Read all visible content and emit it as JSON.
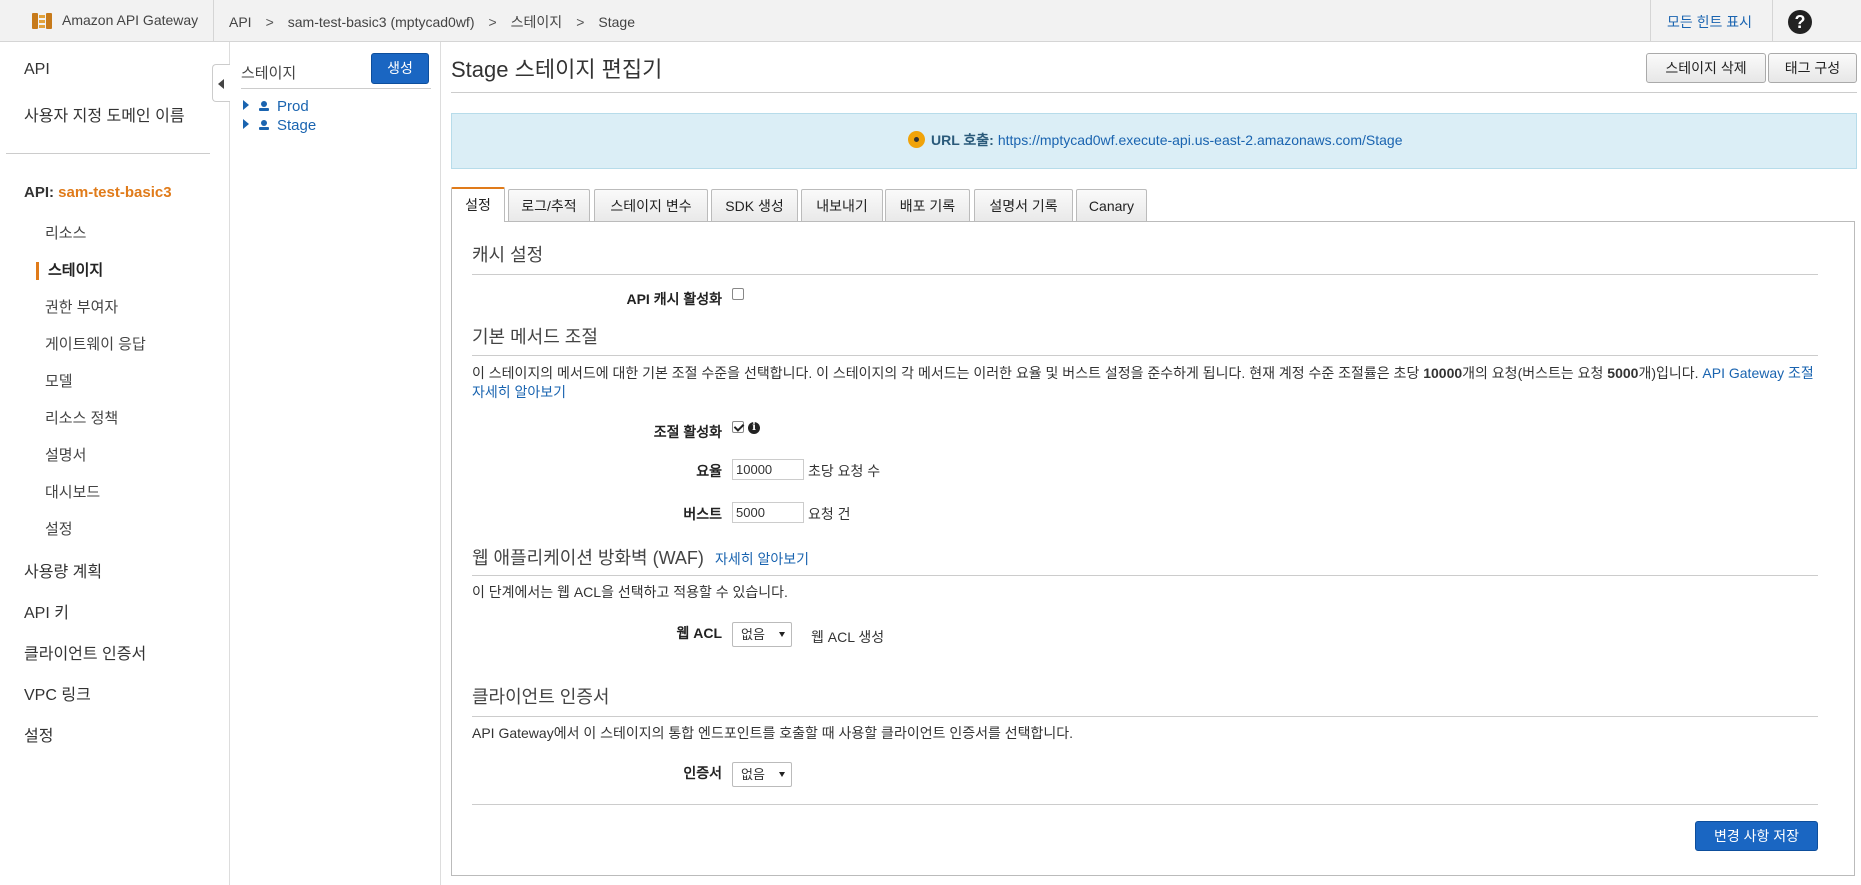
{
  "topbar": {
    "app_name": "Amazon API Gateway",
    "breadcrumbs": [
      "API",
      "sam-test-basic3 (mptycad0wf)",
      "스테이지",
      "Stage"
    ],
    "separator": ">",
    "hint_link": "모든 힌트 표시",
    "help_glyph": "?"
  },
  "leftnav": {
    "top_items": [
      "API",
      "사용자 지정 도메인 이름"
    ],
    "api_prefix": "API:",
    "api_name": "sam-test-basic3",
    "sub_items": [
      "리소스",
      "스테이지",
      "권한 부여자",
      "게이트웨이 응답",
      "모델",
      "리소스 정책",
      "설명서",
      "대시보드",
      "설정"
    ],
    "active_item": "스테이지",
    "bottom_items": [
      "사용량 계획",
      "API 키",
      "클라이언트 인증서",
      "VPC 링크",
      "설정"
    ]
  },
  "stages_panel": {
    "title": "스테이지",
    "create_button": "생성",
    "items": [
      "Prod",
      "Stage"
    ]
  },
  "main": {
    "title": "Stage 스테이지 편집기",
    "delete_button": "스테이지 삭제",
    "tags_button": "태그 구성",
    "url_label": "URL 호출:",
    "url": "https://mptycad0wf.execute-api.us-east-2.amazonaws.com/Stage",
    "tabs": [
      "설정",
      "로그/추적",
      "스테이지 변수",
      "SDK 생성",
      "내보내기",
      "배포 기록",
      "설명서 기록",
      "Canary"
    ],
    "active_tab": "설정"
  },
  "settings": {
    "cache_heading": "캐시 설정",
    "cache_label": "API 캐시 활성화",
    "cache_enabled": false,
    "throttle_heading": "기본 메서드 조절",
    "throttle_desc_1": "이 스테이지의 메서드에 대한 기본 조절 수준을 선택합니다. 이 스테이지의 각 메서드는 이러한 요율 및 버스트 설정을 준수하게 됩니다. 현재 계정 수준 조절률은 초당 ",
    "throttle_rate_bold": "10000",
    "throttle_desc_2": "개의 요청(버스트는 요청 ",
    "throttle_burst_bold": "5000",
    "throttle_desc_3": "개)입니다. ",
    "throttle_link": "API Gateway 조절 자세히 알아보기",
    "throttle_enable_label": "조절 활성화",
    "throttle_enabled": true,
    "info_glyph": "i",
    "rate_label": "요율",
    "rate_value": "10000",
    "rate_unit": "초당 요청 수",
    "burst_label": "버스트",
    "burst_value": "5000",
    "burst_unit": "요청 건",
    "waf_heading": "웹 애플리케이션 방화벽 (WAF)",
    "waf_learn_link": "자세히 알아보기",
    "waf_desc": "이 단계에서는 웹 ACL을 선택하고 적용할 수 있습니다.",
    "waf_acl_label": "웹 ACL",
    "waf_acl_value": "없음",
    "waf_create_link": "웹 ACL 생성",
    "cert_heading": "클라이언트 인증서",
    "cert_desc": "API Gateway에서 이 스테이지의 통합 엔드포인트를 호출할 때 사용할 클라이언트 인증서를 선택합니다.",
    "cert_label": "인증서",
    "cert_value": "없음",
    "save_button": "변경 사항 저장"
  },
  "colors": {
    "accent_orange": "#e07b1a",
    "primary_blue": "#1a66c2",
    "link_blue": "#1a64b0",
    "url_banner_bg": "#dbeef6"
  }
}
